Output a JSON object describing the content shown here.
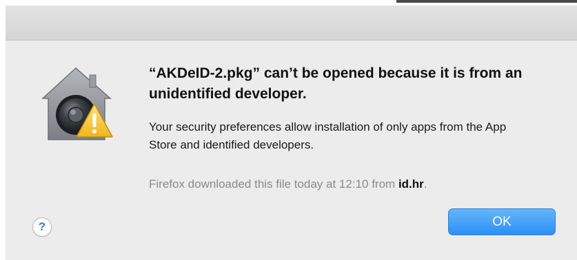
{
  "dialog": {
    "headline": "“AKDeID-2.pkg” can’t be opened because it is from an unidentified developer.",
    "body": "Your security preferences allow installation of only apps from the App Store and identified developers.",
    "source_prefix": "Firefox downloaded this file today at 12:10 from ",
    "source_domain": "id.hr",
    "source_suffix": ".",
    "icon": "gatekeeper-warning-icon"
  },
  "buttons": {
    "help_label": "?",
    "ok_label": "OK"
  },
  "colors": {
    "accent": "#2d8ff5",
    "dialog_background": "#ececec",
    "warning_yellow": "#f6c52b"
  }
}
